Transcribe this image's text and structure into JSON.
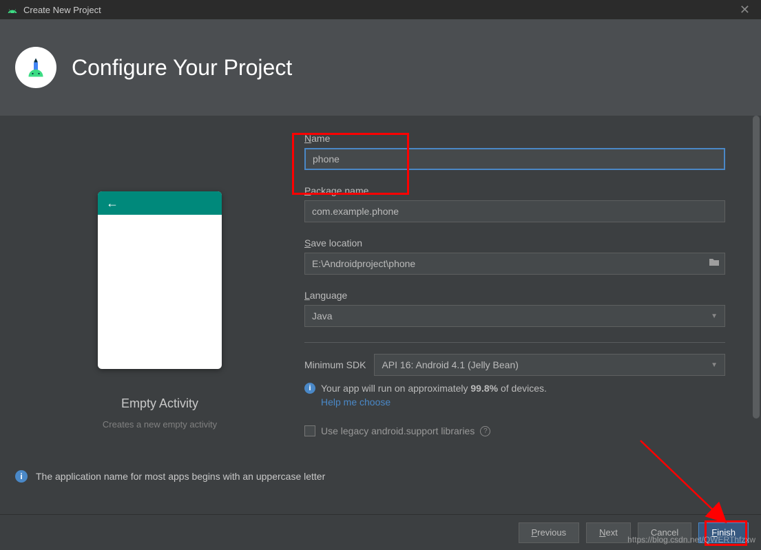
{
  "window": {
    "title": "Create New Project"
  },
  "header": {
    "title": "Configure Your Project"
  },
  "preview": {
    "title": "Empty Activity",
    "subtitle": "Creates a new empty activity"
  },
  "form": {
    "name": {
      "label": "Name",
      "value": "phone"
    },
    "package": {
      "label": "Package name",
      "value": "com.example.phone"
    },
    "location": {
      "label": "Save location",
      "value": "E:\\Androidproject\\phone"
    },
    "language": {
      "label": "Language",
      "value": "Java"
    },
    "sdk": {
      "label": "Minimum SDK",
      "value": "API 16: Android 4.1 (Jelly Bean)"
    },
    "sdk_info_pre": "Your app will run on approximately ",
    "sdk_info_pct": "99.8%",
    "sdk_info_post": " of devices.",
    "help_link": "Help me choose",
    "legacy": "Use legacy android.support libraries"
  },
  "warning": "The application name for most apps begins with an uppercase letter",
  "buttons": {
    "previous": "Previous",
    "next": "Next",
    "cancel": "Cancel",
    "finish": "Finish"
  },
  "watermark": "https://blog.csdn.net/QWERThfzxw"
}
